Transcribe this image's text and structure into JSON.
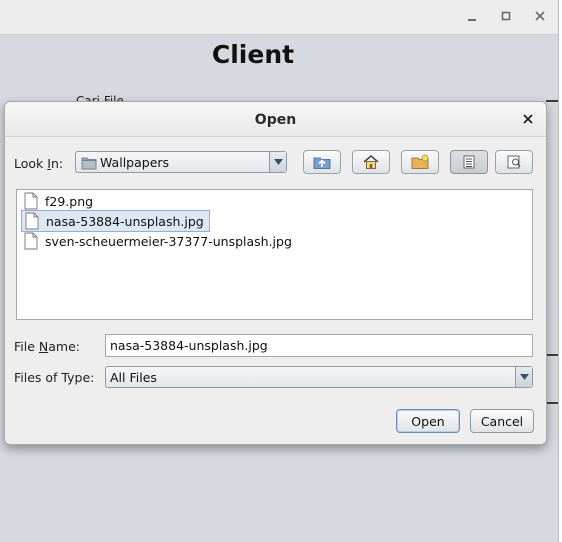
{
  "app": {
    "title": "Client",
    "background_label": "Cari File"
  },
  "window_controls": {
    "minimize_icon": "minimize-icon",
    "maximize_icon": "maximize-icon",
    "close_icon": "close-icon"
  },
  "dialog": {
    "title": "Open",
    "look_in_label_pre": "Look ",
    "look_in_label_mnemonic": "I",
    "look_in_label_post": "n:",
    "look_in_value": "Wallpapers",
    "toolbar": [
      {
        "name": "up-one-level-button",
        "icon": "folder-up-icon"
      },
      {
        "name": "home-button",
        "icon": "home-icon"
      },
      {
        "name": "new-folder-button",
        "icon": "new-folder-icon"
      },
      {
        "name": "list-view-button",
        "icon": "list-view-icon",
        "active": true
      },
      {
        "name": "details-view-button",
        "icon": "details-view-icon"
      }
    ],
    "files": [
      {
        "name": "f29.png",
        "selected": false
      },
      {
        "name": "nasa-53884-unsplash.jpg",
        "selected": true
      },
      {
        "name": "sven-scheuermeier-37377-unsplash.jpg",
        "selected": false
      }
    ],
    "file_name_label_pre": "File ",
    "file_name_label_mnemonic": "N",
    "file_name_label_post": "ame:",
    "file_name_value": "nasa-53884-unsplash.jpg",
    "file_type_label": "Files of Type:",
    "file_type_value": "All Files",
    "open_button": "Open",
    "cancel_button": "Cancel"
  },
  "colors": {
    "selection_bg": "#dde8f4",
    "selection_border": "#8fb0d3",
    "window_bg": "#d6d9df",
    "dialog_bg": "#eeeeee"
  }
}
